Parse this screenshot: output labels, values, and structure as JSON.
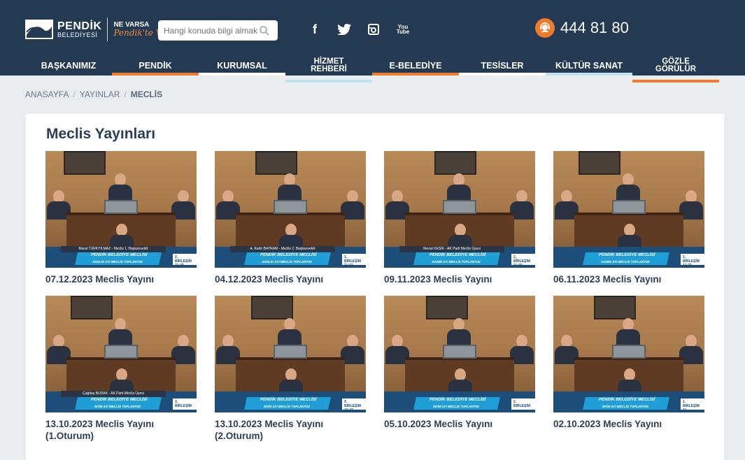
{
  "header": {
    "logo_title": "PENDİK",
    "logo_subtitle": "BELEDİYESİ",
    "slogan_top": "NE VARSA",
    "slogan_script": "Pendik'te Var",
    "search_placeholder": "Hangi konuda bilgi almak istersiniz?",
    "socials": [
      {
        "label": "f",
        "icon": "facebook-icon"
      },
      {
        "label": "🐦",
        "icon": "twitter-icon"
      },
      {
        "label": "◙",
        "icon": "instagram-icon"
      },
      {
        "label": "You Tube",
        "icon": "youtube-icon"
      }
    ],
    "phone": "444 81 80"
  },
  "nav": {
    "items": [
      {
        "label": "BAŞKANIMIZ",
        "underline": "#243a52"
      },
      {
        "label": "PENDİK",
        "underline": "#f07b2c"
      },
      {
        "label": "KURUMSAL",
        "underline": "#ffffff"
      },
      {
        "label": "HİZMET REHBERİ",
        "underline": "#bfe4f1"
      },
      {
        "label": "E-BELEDİYE",
        "underline": "#f07b2c"
      },
      {
        "label": "TESİSLER",
        "underline": "#ffffff"
      },
      {
        "label": "KÜLTÜR SANAT",
        "underline": "#bfe4f1"
      },
      {
        "label": "GÖZLE GÖRÜLÜR",
        "underline": "#f07b2c"
      }
    ]
  },
  "breadcrumb": {
    "home": "ANASAYFA",
    "section": "YAYINLAR",
    "current": "MECLİS"
  },
  "main": {
    "title": "Meclis Yayınları",
    "videos": [
      {
        "title": "07.12.2023 Meclis Yayını",
        "name_strip": "Murat TÜRKYILMAZ - Meclis 1. Başkanvekili",
        "banner": "PENDİK BELEDİYE MECLİSİ",
        "banner_sub": "ARALIK AYI MECLİS TOPLANTISI",
        "corner": "2. BİRLEŞİM 11:34"
      },
      {
        "title": "04.12.2023 Meclis Yayını",
        "name_strip": "A. Kadir BAYRAM - Meclis 2. Başkanvekili",
        "banner": "PENDİK BELEDİYE MECLİSİ",
        "banner_sub": "ARALIK AYI MECLİS TOPLANTISI",
        "corner": "1. BİRLEŞİM 11:47"
      },
      {
        "title": "09.11.2023 Meclis Yayını",
        "name_strip": "Mesut KESİK - AK Parti Meclis Üyesi",
        "banner": "PENDİK BELEDİYE MECLİSİ",
        "banner_sub": "KASIM AYI MECLİS TOPLANTISI",
        "corner": "2. BİRLEŞİM 11:15"
      },
      {
        "title": "06.11.2023 Meclis Yayını",
        "name_strip": "",
        "banner": "PENDİK BELEDİYE MECLİSİ",
        "banner_sub": "KASIM AYI MECLİS TOPLANTISI",
        "corner": "1. BİRLEŞİM 11:23"
      },
      {
        "title": "13.10.2023 Meclis Yayını (1.Oturum)",
        "name_strip": "Çağdaş BUDAK - AK Parti Meclis Üyesi",
        "banner": "PENDİK BELEDİYE MECLİSİ",
        "banner_sub": "EKİM AYI MECLİS TOPLANTISI",
        "corner": "3. BİRLEŞİM"
      },
      {
        "title": "13.10.2023 Meclis Yayını (2.Oturum)",
        "name_strip": "",
        "banner": "PENDİK BELEDİYE MECLİSİ",
        "banner_sub": "EKİM AYI MECLİS TOPLANTISI",
        "corner": "3. BİRLEŞİM 16:43"
      },
      {
        "title": "05.10.2023 Meclis Yayını",
        "name_strip": "",
        "banner": "PENDİK BELEDİYE MECLİSİ",
        "banner_sub": "EKİM AYI MECLİS TOPLANTISI",
        "corner": "2. BİRLEŞİM"
      },
      {
        "title": "02.10.2023 Meclis Yayını",
        "name_strip": "",
        "banner": "PENDİK BELEDİYE MECLİSİ",
        "banner_sub": "EKİM AYI MECLİS TOPLANTISI",
        "corner": "1. BİRLEŞİM 11"
      }
    ]
  },
  "colors": {
    "header_bg": "#243a52",
    "accent_orange": "#f07b2c",
    "accent_light_blue": "#bfe4f1",
    "page_bg": "#e9edf0"
  }
}
